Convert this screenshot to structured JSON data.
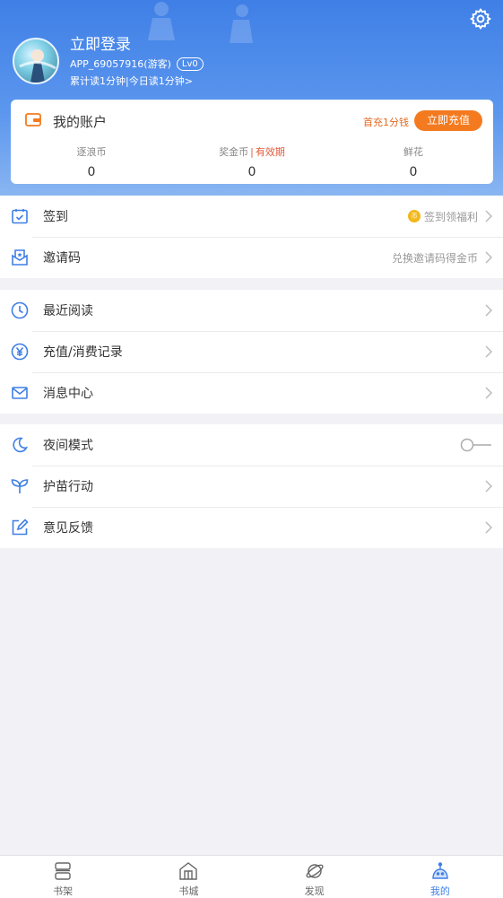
{
  "header": {
    "login_title": "立即登录",
    "user_id": "APP_69057916(游客)",
    "level_badge": "Lv0",
    "read_stats": "累计读1分钟|今日读1分钟>"
  },
  "account": {
    "title": "我的账户",
    "promo": "首充1分钱",
    "recharge_button": "立即充值",
    "stats": [
      {
        "label": "逐浪币",
        "value": "0"
      },
      {
        "label": "奖金币",
        "extra": "有效期",
        "value": "0"
      },
      {
        "label": "鲜花",
        "value": "0"
      }
    ]
  },
  "menu_group1": [
    {
      "label": "签到",
      "right": "签到领福利",
      "coin": "币",
      "icon": "calendar-check-icon"
    },
    {
      "label": "邀请码",
      "right": "兑换邀请码得金币",
      "icon": "invite-mail-icon"
    }
  ],
  "menu_group2": [
    {
      "label": "最近阅读",
      "icon": "clock-icon"
    },
    {
      "label": "充值/消费记录",
      "icon": "yen-circle-icon"
    },
    {
      "label": "消息中心",
      "icon": "mail-icon"
    }
  ],
  "menu_group3": [
    {
      "label": "夜间模式",
      "icon": "moon-icon",
      "toggle": false
    },
    {
      "label": "护苗行动",
      "icon": "sprout-icon"
    },
    {
      "label": "意见反馈",
      "icon": "edit-icon"
    }
  ],
  "tabbar": [
    {
      "label": "书架",
      "icon": "bookshelf-icon"
    },
    {
      "label": "书城",
      "icon": "bookstore-icon"
    },
    {
      "label": "发现",
      "icon": "planet-icon"
    },
    {
      "label": "我的",
      "icon": "profile-icon",
      "active": true
    }
  ],
  "colors": {
    "accent": "#3f7fe6",
    "orange": "#f47a1f",
    "red": "#e05a38"
  }
}
